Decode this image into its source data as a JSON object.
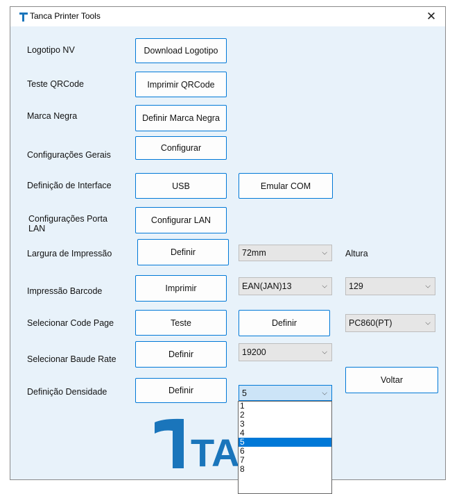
{
  "window": {
    "title": "Tanca Printer Tools",
    "close_glyph": "✕"
  },
  "rows": {
    "logotipo": {
      "label": "Logotipo NV",
      "button": "Download Logotipo"
    },
    "qrcode": {
      "label": "Teste QRCode",
      "button": "Imprimir QRCode"
    },
    "marca": {
      "label": "Marca Negra",
      "button": "Definir Marca Negra"
    },
    "config": {
      "label": "Configurações Gerais",
      "button": "Configurar"
    },
    "interface": {
      "label": "Definição de Interface",
      "button": "USB",
      "button2": "Emular COM"
    },
    "lan": {
      "label": "Configurações Porta LAN",
      "button": "Configurar LAN"
    },
    "largura": {
      "label": "Largura de Impressão",
      "button": "Definir",
      "combo": "72mm",
      "label2": "Altura"
    },
    "barcode": {
      "label": "Impressão Barcode",
      "button": "Imprimir",
      "combo": "EAN(JAN)13",
      "combo2": "129"
    },
    "codepage": {
      "label": "Selecionar Code Page",
      "button": "Teste",
      "button2": "Definir",
      "combo": "PC860(PT)"
    },
    "baud": {
      "label": "Selecionar Baude Rate",
      "button": "Definir",
      "combo": "19200"
    },
    "densidade": {
      "label": "Definição Densidade",
      "button": "Definir",
      "combo": "5",
      "options": [
        "1",
        "2",
        "3",
        "4",
        "5",
        "6",
        "7",
        "8"
      ],
      "selected_index": 4
    }
  },
  "voltar": "Voltar",
  "logo_text": "TA",
  "colors": {
    "accent": "#0078d7",
    "logo_blue": "#1a75bb",
    "client_bg": "#e8f2fa"
  },
  "icons": {
    "combo_arrow": "⌵"
  }
}
